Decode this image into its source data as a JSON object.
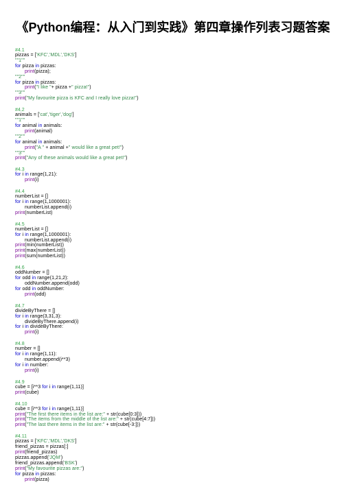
{
  "title": "《Python编程：从入门到实践》第四章操作列表习题答案",
  "s41": {
    "h": "#4.1",
    "l1_a": "pizzas = [",
    "l1_b": "'KFC','MDL','DKS'",
    "l1_c": "]",
    "l2": "\"\"1\"\"",
    "l3_a": "for",
    "l3_b": " pizza ",
    "l3_c": "in",
    "l3_d": " pizzas:",
    "l4_a": "print",
    "l4_b": "(pizza);",
    "l5": "\"\"2\"\"",
    "l6_a": "for",
    "l6_b": " pizza ",
    "l6_c": "in",
    "l6_d": " pizzas:",
    "l7_a": "print",
    "l7_b": "(",
    "l7_c": "\"I like \"",
    "l7_d": "+ pizza +",
    "l7_e": "\" pizza!\"",
    "l7_f": ")",
    "l8": "\"\"3\"\"",
    "l9_a": "print",
    "l9_b": "(",
    "l9_c": "\"My favourite pizza is KFC and I really love pizza!\"",
    "l9_d": ")"
  },
  "s42": {
    "h": "#4.2",
    "l1_a": "animals = [",
    "l1_b": "'cat','tiger','dog'",
    "l1_c": "]",
    "l2": "\"\"1\"\"",
    "l3_a": "for",
    "l3_b": " animal ",
    "l3_c": "in",
    "l3_d": " animals:",
    "l4_a": "print",
    "l4_b": "(animal)",
    "l5": "\"\"2\"\"",
    "l6_a": "for",
    "l6_b": " animal ",
    "l6_c": "in",
    "l6_d": " animals:",
    "l7_a": "print",
    "l7_b": "(",
    "l7_c": "\"A \"",
    "l7_d": " + animal +",
    "l7_e": "\" would like a great pet!\"",
    "l7_f": ")",
    "l8": "\"\"3\"\"",
    "l9_a": "print",
    "l9_b": "(",
    "l9_c": "\"Any of these animals would like a great pet!\"",
    "l9_d": ")"
  },
  "s43": {
    "h": "#4.3",
    "l1_a": "for",
    "l1_b": " i ",
    "l1_c": "in",
    "l1_d": " range(1,21):",
    "l2_a": "print",
    "l2_b": "(i)"
  },
  "s44": {
    "h": "#4.4",
    "l1": "numberList = []",
    "l2_a": "for",
    "l2_b": " i ",
    "l2_c": "in",
    "l2_d": " range(1,1000001):",
    "l3": "numberList.append(i)",
    "l4_a": "print",
    "l4_b": "(numberList)"
  },
  "s45": {
    "h": "#4.5",
    "l1": "numberList = []",
    "l2_a": "for",
    "l2_b": " i ",
    "l2_c": "in",
    "l2_d": " range(1,1000001):",
    "l3": "numberList.append(i)",
    "l4_a": "print",
    "l4_b": "(min(numberList))",
    "l5_a": "print",
    "l5_b": "(max(numberList))",
    "l6_a": "print",
    "l6_b": "(sum(numberList))"
  },
  "s46": {
    "h": "#4.6",
    "l1": "oddNumber = []",
    "l2_a": "for",
    "l2_b": " odd ",
    "l2_c": "in",
    "l2_d": " range(1,21,2):",
    "l3": "oddNumber.append(odd)",
    "l4_a": "for",
    "l4_b": " odd ",
    "l4_c": "in",
    "l4_d": " oddNumber:",
    "l5_a": "print",
    "l5_b": "(odd)"
  },
  "s47": {
    "h": "#4.7",
    "l1": "divideByThere = []",
    "l2_a": "for",
    "l2_b": " i ",
    "l2_c": "in",
    "l2_d": " range(3,31,3):",
    "l3": "divideByThere.append(i)",
    "l4_a": "for",
    "l4_b": " i ",
    "l4_c": "in",
    "l4_d": " divideByThere:",
    "l5_a": "print",
    "l5_b": "(i)"
  },
  "s48": {
    "h": "#4.8",
    "l1": "number = []",
    "l2_a": "for",
    "l2_b": " i ",
    "l2_c": "in",
    "l2_d": " range(1,11):",
    "l3": "number.append(i**3)",
    "l4_a": "for",
    "l4_b": " i ",
    "l4_c": "in",
    "l4_d": " number:",
    "l5_a": "print",
    "l5_b": "(i)"
  },
  "s49": {
    "h": "#4.9",
    "l1_a": "cube = [i**3 ",
    "l1_b": "for",
    "l1_c": " i ",
    "l1_d": "in",
    "l1_e": " range(1,11)]",
    "l2_a": "print",
    "l2_b": "(cube)"
  },
  "s410": {
    "h": "#4.10",
    "l1_a": "cube = [i**3 ",
    "l1_b": "for",
    "l1_c": " i ",
    "l1_d": "in",
    "l1_e": " range(1,11)]",
    "l2_a": "print",
    "l2_b": "(",
    "l2_c": "\"The first there items in the list are:\"",
    "l2_d": " + str(cube[0:3]))",
    "l3_a": "print",
    "l3_b": "(",
    "l3_c": "\"The items from the middle of the list are:\"",
    "l3_d": " + str(cube[4:7]))",
    "l4_a": "print",
    "l4_b": "(",
    "l4_c": "\"The last there items in the list are:\"",
    "l4_d": " + str(cube[-3:]))"
  },
  "s411": {
    "h": "#4.11",
    "l1_a": "pizzas = [",
    "l1_b": "'KFC','MDL','DKS'",
    "l1_c": "]",
    "l2": "friend_pizzas = pizzas[:]",
    "l3_a": "print",
    "l3_b": "(friend_pizzas)",
    "l4_a": "pizzas.append(",
    "l4_b": "'JQM'",
    "l4_c": ")",
    "l5_a": "friend_pizzas.append(",
    "l5_b": "'BSK'",
    "l5_c": ")",
    "l6_a": "print",
    "l6_b": "(",
    "l6_c": "\"My favourite pizzas are:\"",
    "l6_d": ")",
    "l7_a": "for",
    "l7_b": " pizza ",
    "l7_c": "in",
    "l7_d": " pizzas:",
    "l8_a": "print",
    "l8_b": "(pizza)"
  }
}
